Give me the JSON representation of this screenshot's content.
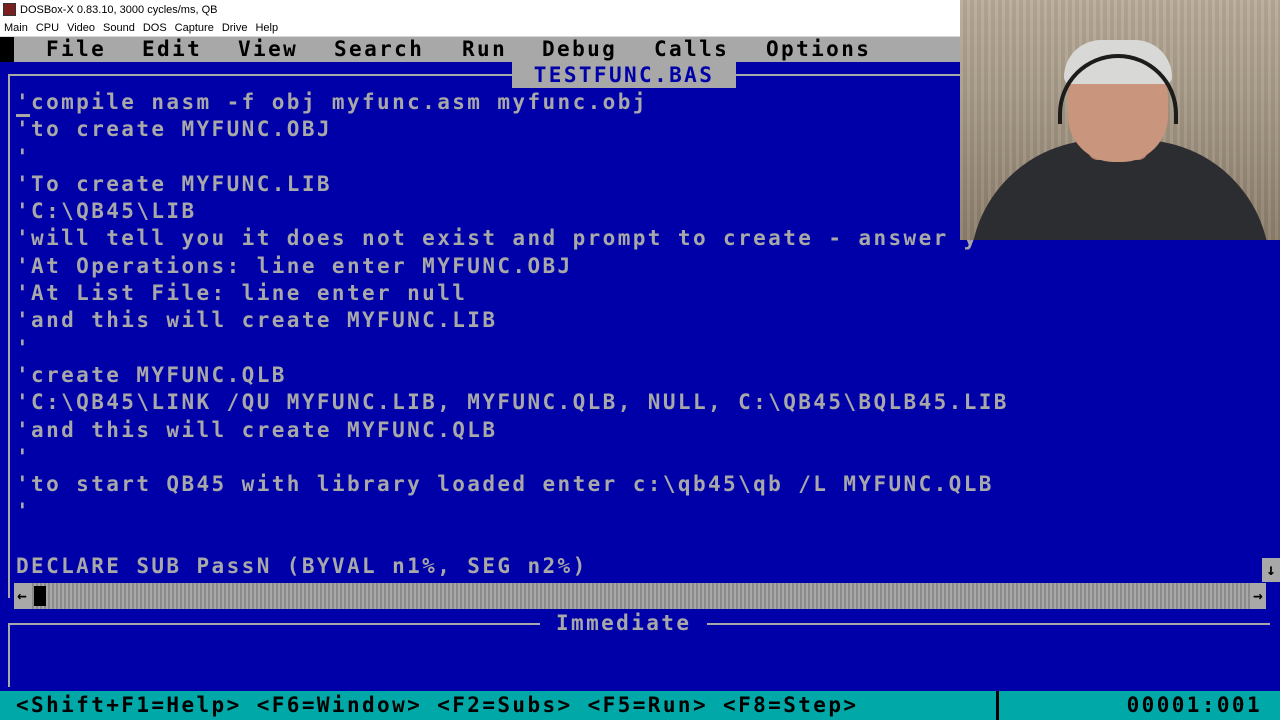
{
  "window": {
    "title": "DOSBox-X 0.83.10, 3000 cycles/ms, QB",
    "menu": [
      "Main",
      "CPU",
      "Video",
      "Sound",
      "DOS",
      "Capture",
      "Drive",
      "Help"
    ]
  },
  "qb": {
    "menu": [
      "File",
      "Edit",
      "View",
      "Search",
      "Run",
      "Debug",
      "Calls",
      "Options"
    ],
    "file_title": "TESTFUNC.BAS",
    "code_lines": [
      "'compile nasm -f obj myfunc.asm myfunc.obj",
      "'to create MYFUNC.OBJ",
      "'",
      "'To create MYFUNC.LIB",
      "'C:\\QB45\\LIB",
      "'will tell you it does not exist and prompt to create - answer y",
      "'At Operations: line enter MYFUNC.OBJ",
      "'At List File: line enter null",
      "'and this will create MYFUNC.LIB",
      "'",
      "'create MYFUNC.QLB",
      "'C:\\QB45\\LINK /QU MYFUNC.LIB, MYFUNC.QLB, NULL, C:\\QB45\\BQLB45.LIB",
      "'and this will create MYFUNC.QLB",
      "'",
      "'to start QB45 with library loaded enter c:\\qb45\\qb /L MYFUNC.QLB",
      "'",
      "",
      "DECLARE SUB PassN (BYVAL n1%, SEG n2%)"
    ],
    "immediate_title": "Immediate",
    "status_keys": "<Shift+F1=Help> <F6=Window> <F2=Subs> <F5=Run> <F8=Step>",
    "cursor_pos": "00001:001",
    "colors": {
      "background": "#0000a8",
      "foreground": "#a8a8a8",
      "status_bar": "#00a8a8"
    }
  },
  "icons": {
    "scroll_down": "↓",
    "scroll_left": "←",
    "scroll_right": "→"
  }
}
